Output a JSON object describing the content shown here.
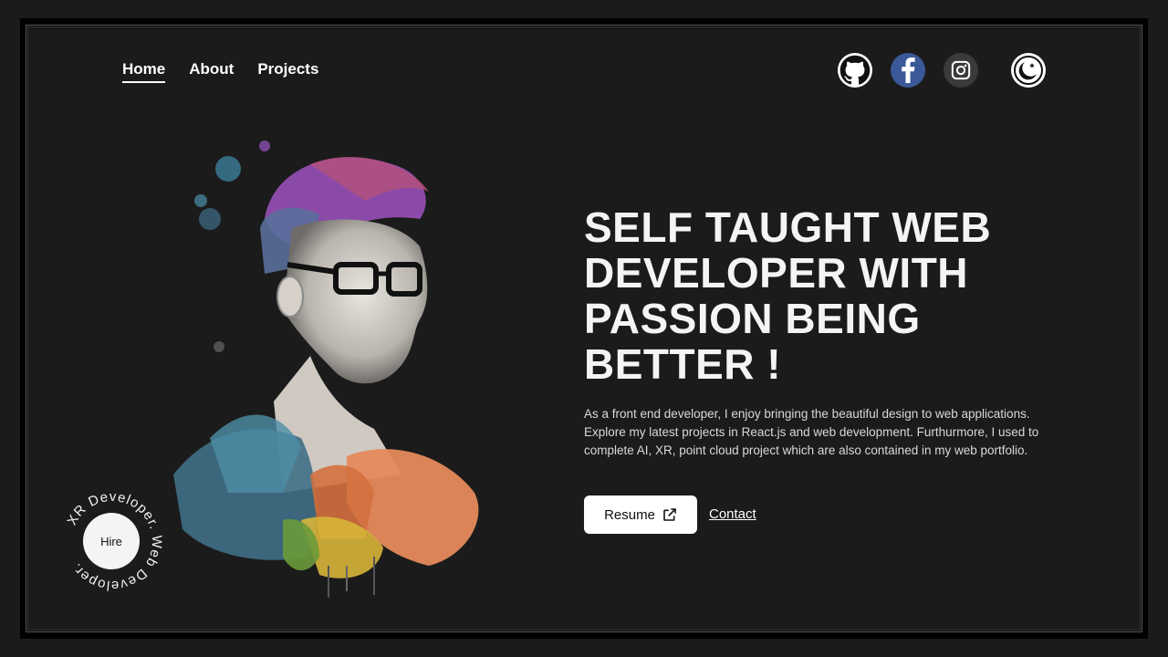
{
  "nav": {
    "items": [
      {
        "label": "Home",
        "active": true
      },
      {
        "label": "About",
        "active": false
      },
      {
        "label": "Projects",
        "active": false
      }
    ]
  },
  "social": {
    "icons": [
      "github-icon",
      "facebook-icon",
      "instagram-icon"
    ]
  },
  "theme_toggle": {
    "icon": "moon-star-icon"
  },
  "hero": {
    "headline": "SELF TAUGHT WEB DEVELOPER WITH PASSION BEING BETTER !",
    "description": "As a front end developer, I enjoy bringing the beautiful design to web applications. Explore my latest projects in React.js and web development. Furthurmore, I used to complete AI, XR, point cloud project which are also contained in my web portfolio.",
    "resume_label": "Resume",
    "contact_label": "Contact"
  },
  "hire_badge": {
    "label": "Hire",
    "ring_text": "XR Developer. Web Developer."
  },
  "colors": {
    "background": "#1b1b1b",
    "text": "#f4f4f4",
    "facebook": "#3b5998",
    "instagram_bg": "#3a3a3a"
  }
}
